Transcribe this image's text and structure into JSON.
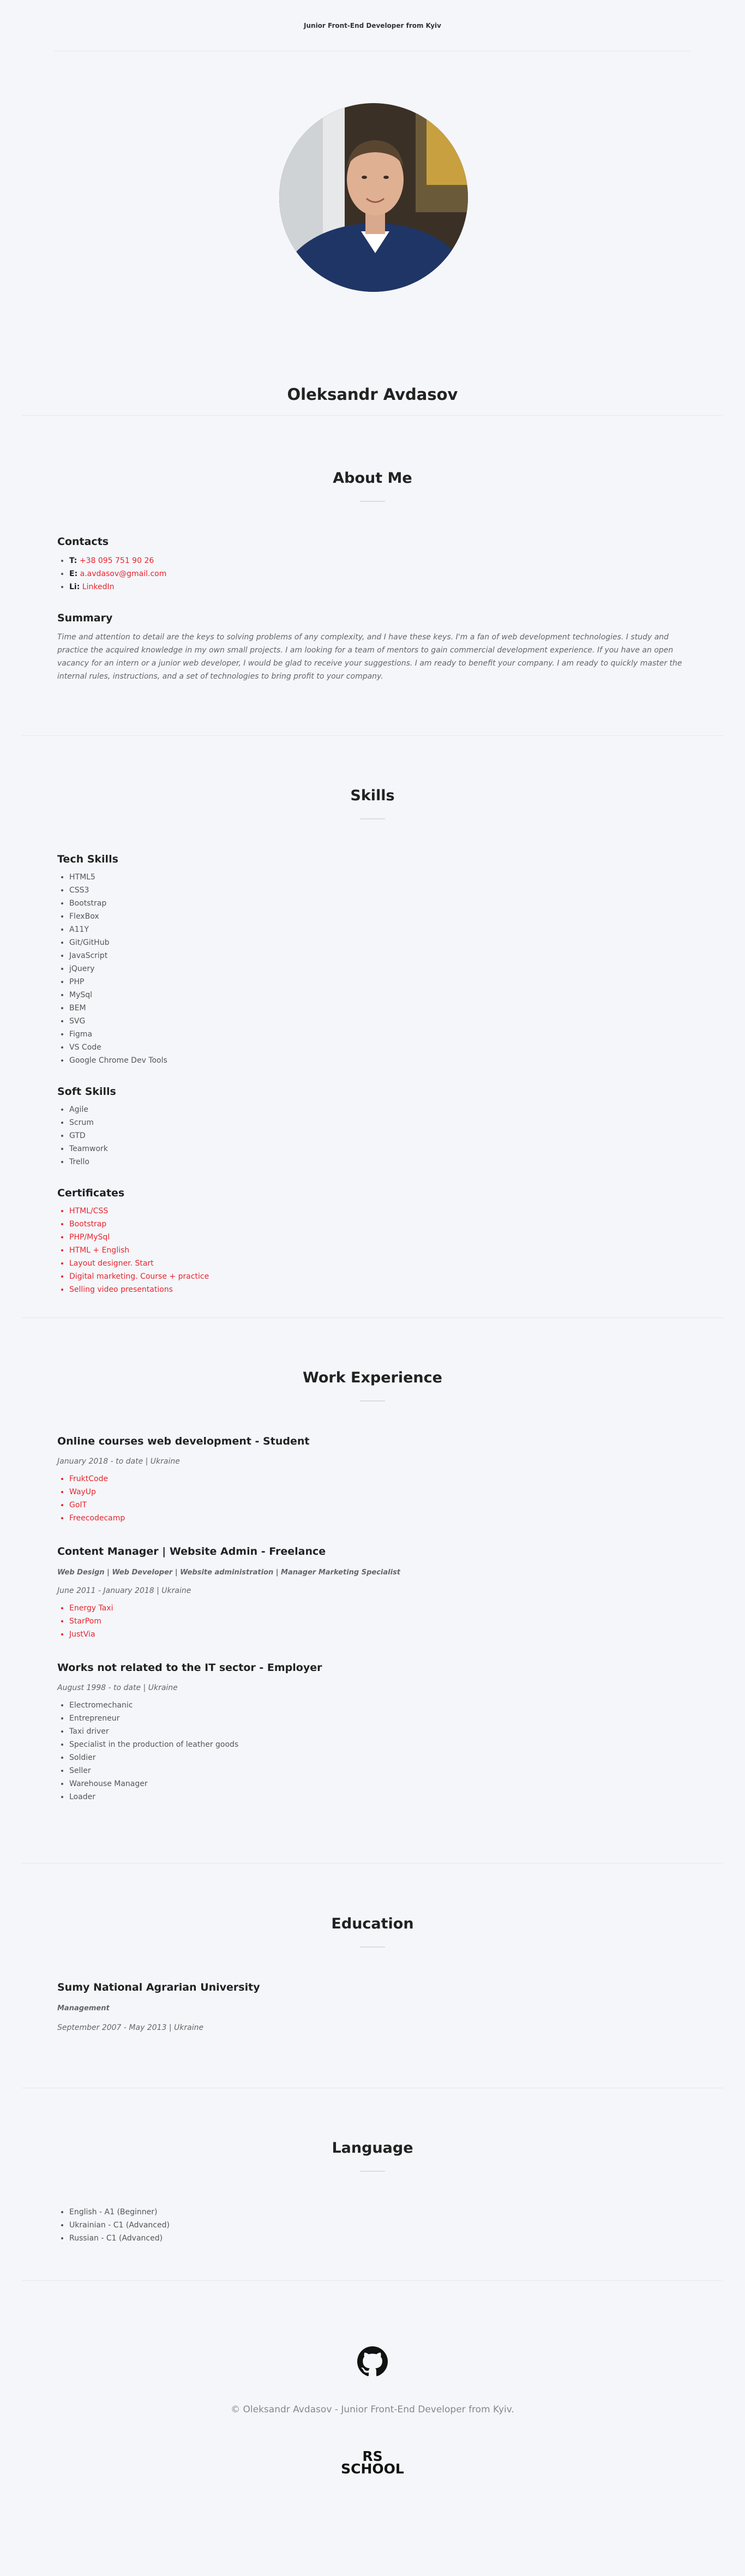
{
  "header": {
    "tagline": "Junior Front-End Developer from Kyiv"
  },
  "hero": {
    "name": "Oleksandr Avdasov"
  },
  "about": {
    "title": "About Me",
    "contacts_title": "Contacts",
    "contacts": [
      {
        "key": "T:",
        "value": "+38 095 751 90 26"
      },
      {
        "key": "E:",
        "value": "a.avdasov@gmail.com"
      },
      {
        "key": "Li:",
        "value": "LinkedIn"
      }
    ],
    "summary_title": "Summary",
    "summary": "Time and attention to detail are the keys to solving problems of any complexity, and I have these keys. I'm a fan of web development technologies. I study and practice the acquired knowledge in my own small projects. I am looking for a team of mentors to gain commercial development experience. If you have an open vacancy for an intern or a junior web developer, I would be glad to receive your suggestions. I am ready to benefit your company. I am ready to quickly master the internal rules, instructions, and a set of technologies to bring profit to your company."
  },
  "skills": {
    "title": "Skills",
    "tech_title": "Tech Skills",
    "tech": [
      "HTML5",
      "CSS3",
      "Bootstrap",
      "FlexBox",
      "A11Y",
      "Git/GitHub",
      "JavaScript",
      "jQuery",
      "PHP",
      "MySql",
      "BEM",
      "SVG",
      "Figma",
      "VS Code",
      "Google Chrome Dev Tools"
    ],
    "soft_title": "Soft Skills",
    "soft": [
      "Agile",
      "Scrum",
      "GTD",
      "Teamwork",
      "Trello"
    ],
    "cert_title": "Certificates",
    "certs": [
      "HTML/CSS",
      "Bootstrap",
      "PHP/MySql",
      "HTML + English",
      "Layout designer. Start",
      "Digital marketing. Course + practice",
      "Selling video presentations"
    ]
  },
  "work": {
    "title": "Work Experience",
    "jobs": [
      {
        "title": "Online courses web development - Student",
        "dates": "January 2018 - to date | Ukraine",
        "items": [
          "FruktCode",
          "WayUp",
          "GoIT",
          "Freecodecamp"
        ]
      },
      {
        "title": "Content Manager | Website Admin - Freelance",
        "subtitle": "Web Design | Web Developer | Website administration | Manager Marketing Specialist",
        "dates": "June 2011 - January 2018 | Ukraine",
        "items": [
          "Energy Taxi",
          "StarPom",
          "JustVia"
        ]
      },
      {
        "title": "Works not related to the IT sector - Employer",
        "dates": "August 1998 - to date | Ukraine",
        "items": [
          "Electromechanic",
          "Entrepreneur",
          "Taxi driver",
          "Specialist in the production of leather goods",
          "Soldier",
          "Seller",
          "Warehouse Manager",
          "Loader"
        ]
      }
    ]
  },
  "education": {
    "title": "Education",
    "school": "Sumy National Agrarian University",
    "degree": "Management",
    "dates": "September 2007 - May 2013 | Ukraine"
  },
  "language": {
    "title": "Language",
    "items": [
      "English - A1 (Beginner)",
      "Ukrainian - C1 (Advanced)",
      "Russian - C1 (Advanced)"
    ]
  },
  "footer": {
    "copyright": "© Oleksandr Avdasov - Junior Front-End Developer from Kyiv.",
    "logo_text": "RS SCHOOL"
  }
}
